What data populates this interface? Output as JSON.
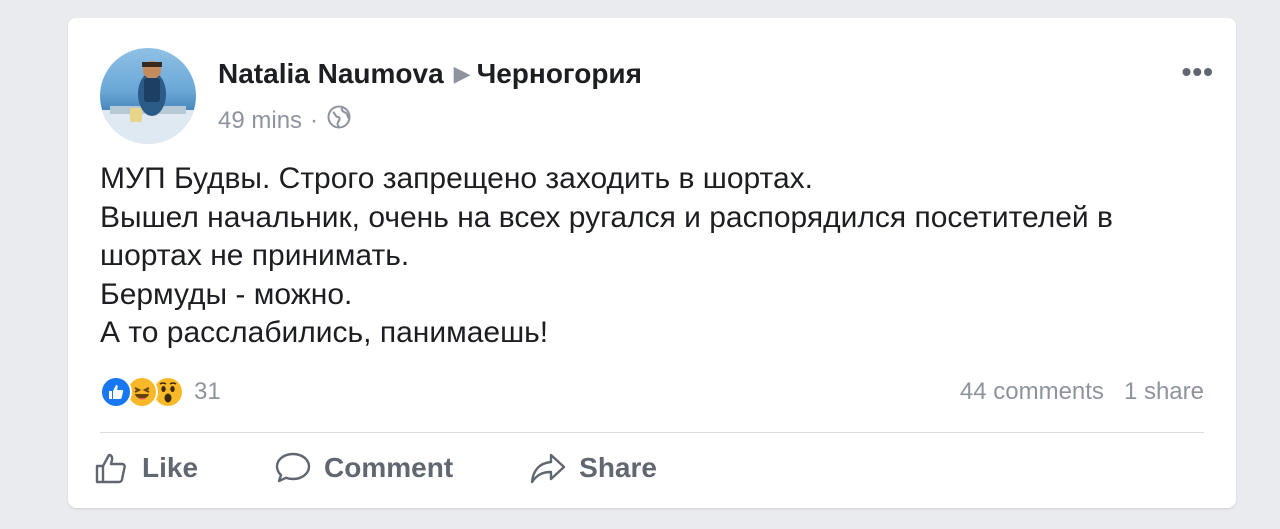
{
  "post": {
    "author": "Natalia Naumova",
    "arrow": "▶",
    "group": "Черногория",
    "time": "49 mins",
    "separator": "·",
    "privacy_icon": "globe-icon",
    "more_label": "•••",
    "lines": [
      "МУП Будвы. Строго запрещено заходить в шортах.",
      "Вышел начальник, очень на всех ругался и распорядился посетителей в шортах не принимать.",
      "Бермуды - можно.",
      "А то расслабились, панимаешь!"
    ]
  },
  "reactions": {
    "icons": [
      "like-icon",
      "haha-icon",
      "wow-icon"
    ],
    "count": "31"
  },
  "stats": {
    "comments": "44 comments",
    "shares": "1 share"
  },
  "actions": {
    "like": "Like",
    "comment": "Comment",
    "share": "Share"
  },
  "colors": {
    "like_blue": "#1877f2",
    "emoji_yellow": "#f7b928",
    "muted_text": "#8d949e",
    "action_text": "#606770"
  }
}
